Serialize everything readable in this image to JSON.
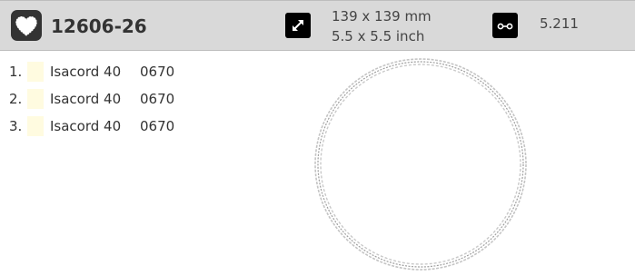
{
  "header": {
    "design_number": "12606-26",
    "logo_icon": "heart-icon",
    "size_icon": "resize-arrows-icon",
    "size_mm": "139 x 139 mm",
    "size_inch": "5.5 x 5.5 inch",
    "stitch_icon": "stitch-count-icon",
    "stitch_count": "5.211"
  },
  "threads": [
    {
      "index": "1.",
      "brand": "Isacord 40",
      "code": "0670",
      "color": "#fffbe0"
    },
    {
      "index": "2.",
      "brand": "Isacord 40",
      "code": "0670",
      "color": "#fffbe0"
    },
    {
      "index": "3.",
      "brand": "Isacord 40",
      "code": "0670",
      "color": "#fffbe0"
    }
  ],
  "preview": {
    "shape": "circle-outline",
    "stroke_color": "#b0b0b0"
  }
}
